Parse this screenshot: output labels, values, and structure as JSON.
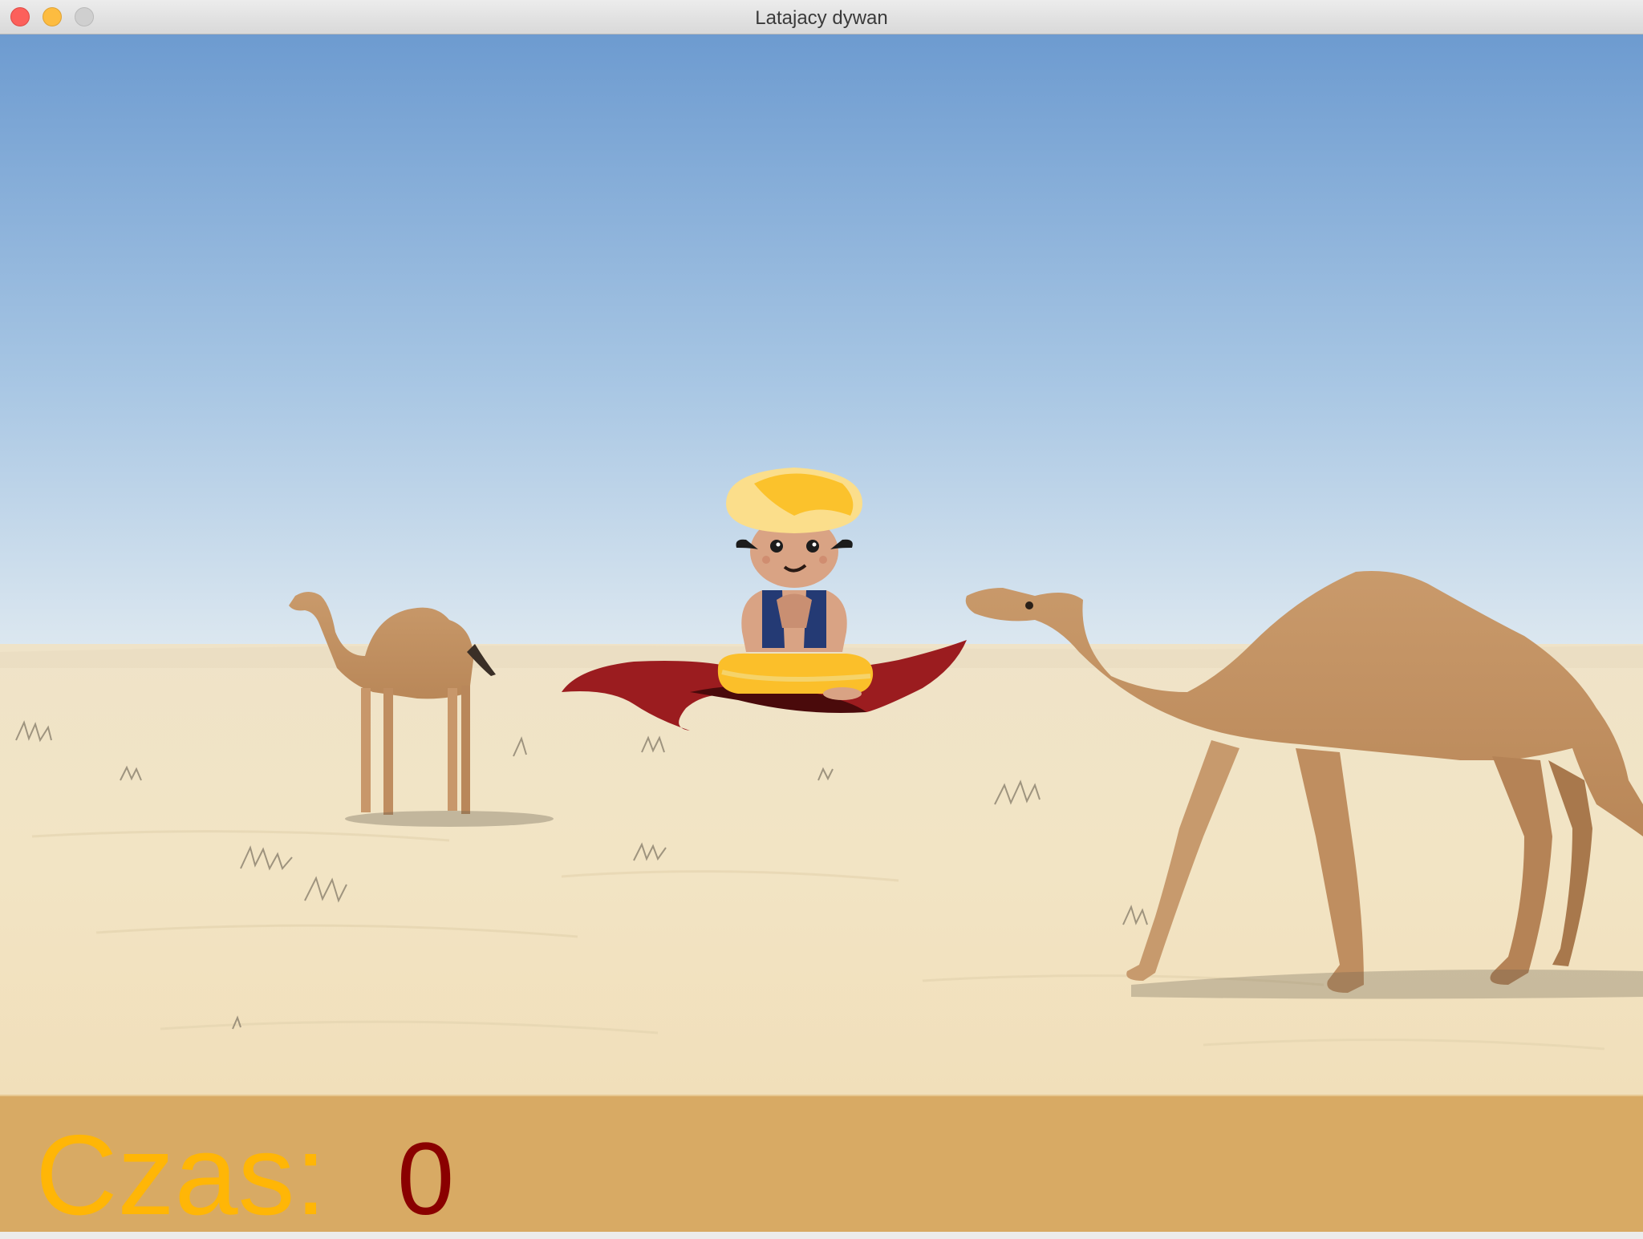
{
  "window": {
    "title": "Latajacy dywan",
    "controls": [
      "close-button",
      "minimize-button",
      "zoom-button"
    ]
  },
  "scene": {
    "background": "desert",
    "sprites": [
      "player-aladdin-on-flying-carpet",
      "camel-left",
      "camel-right"
    ]
  },
  "hud": {
    "time_label": "Czas:",
    "time_value": "0",
    "label_color": "#ffb606",
    "value_color": "#8a0000",
    "bar_color": "#d8aa64"
  }
}
